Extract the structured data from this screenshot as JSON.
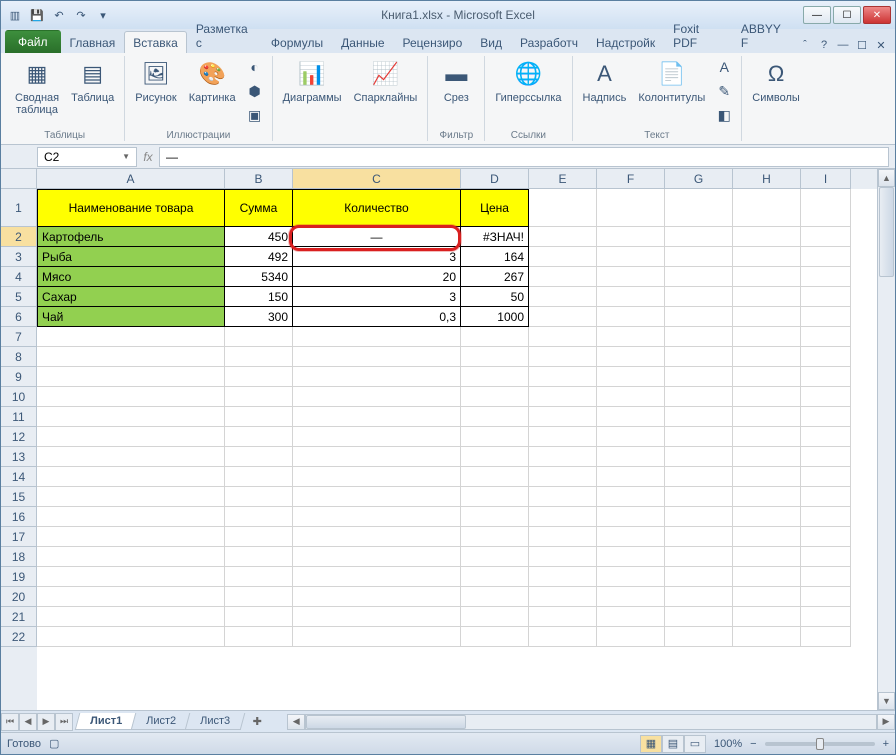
{
  "app_title": "Книга1.xlsx - Microsoft Excel",
  "qat": {
    "save": "💾",
    "undo": "↶",
    "redo": "↷",
    "more": "▾"
  },
  "win": {
    "min": "—",
    "max": "☐",
    "close": "✕"
  },
  "tabs": {
    "file": "Файл",
    "home": "Главная",
    "insert": "Вставка",
    "layout": "Разметка с",
    "formulas": "Формулы",
    "data": "Данные",
    "review": "Рецензиро",
    "view": "Вид",
    "dev": "Разработч",
    "addins": "Надстройк",
    "foxit": "Foxit PDF",
    "abbyy": "ABBYY F"
  },
  "ribbon": {
    "tables": {
      "pivot": "Сводная\nтаблица",
      "table": "Таблица",
      "label": "Таблицы"
    },
    "illus": {
      "pic": "Рисунок",
      "clip": "Картинка",
      "label": "Иллюстрации"
    },
    "charts": {
      "chart": "Диаграммы",
      "spark": "Спарклайны"
    },
    "filter": {
      "slicer": "Срез",
      "label": "Фильтр"
    },
    "links": {
      "hyper": "Гиперссылка",
      "label": "Ссылки"
    },
    "text": {
      "textbox": "Надпись",
      "hf": "Колонтитулы",
      "label": "Текст"
    },
    "symbols": {
      "sym": "Символы"
    }
  },
  "formula_bar": {
    "cell_ref": "C2",
    "fx": "fx",
    "value": "—"
  },
  "columns": [
    {
      "l": "A",
      "w": 188
    },
    {
      "l": "B",
      "w": 68
    },
    {
      "l": "C",
      "w": 168
    },
    {
      "l": "D",
      "w": 68
    },
    {
      "l": "E",
      "w": 68
    },
    {
      "l": "F",
      "w": 68
    },
    {
      "l": "G",
      "w": 68
    },
    {
      "l": "H",
      "w": 68
    },
    {
      "l": "I",
      "w": 50
    }
  ],
  "rows_shown": 22,
  "table": {
    "headers": [
      "Наименование товара",
      "Сумма",
      "Количество",
      "Цена"
    ],
    "rows": [
      {
        "name": "Картофель",
        "sum": "450",
        "qty": "—",
        "price": "#ЗНАЧ!"
      },
      {
        "name": "Рыба",
        "sum": "492",
        "qty": "3",
        "price": "164"
      },
      {
        "name": "Мясо",
        "sum": "5340",
        "qty": "20",
        "price": "267"
      },
      {
        "name": "Сахар",
        "sum": "150",
        "qty": "3",
        "price": "50"
      },
      {
        "name": "Чай",
        "sum": "300",
        "qty": "0,3",
        "price": "1000"
      }
    ]
  },
  "sheets": {
    "s1": "Лист1",
    "s2": "Лист2",
    "s3": "Лист3"
  },
  "status": {
    "ready": "Готово",
    "zoom": "100%",
    "minus": "−",
    "plus": "+"
  }
}
